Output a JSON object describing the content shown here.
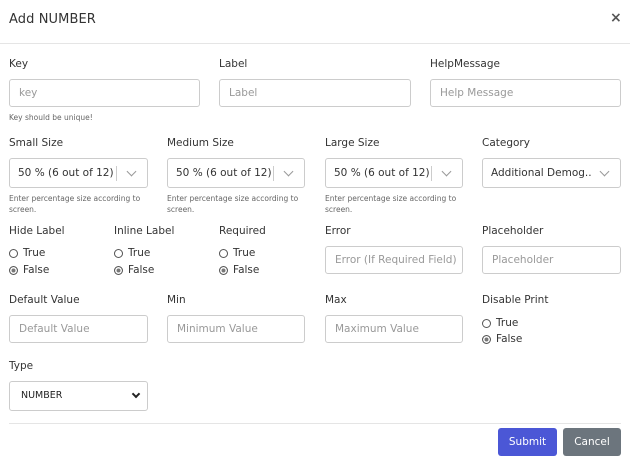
{
  "modal": {
    "title": "Add NUMBER",
    "close_icon": "×"
  },
  "fields": {
    "key": {
      "label": "Key",
      "placeholder": "key",
      "hint": "Key should be unique!"
    },
    "label": {
      "label": "Label",
      "placeholder": "Label"
    },
    "help_message": {
      "label": "HelpMessage",
      "placeholder": "Help Message"
    },
    "small_size": {
      "label": "Small Size",
      "value": "50 % (6 out of 12)",
      "hint": "Enter percentage size according to screen."
    },
    "medium_size": {
      "label": "Medium Size",
      "value": "50 % (6 out of 12)",
      "hint": "Enter percentage size according to screen."
    },
    "large_size": {
      "label": "Large Size",
      "value": "50 % (6 out of 12)",
      "hint": "Enter percentage size according to screen."
    },
    "category": {
      "label": "Category",
      "value": "Additional Demog..."
    },
    "hide_label": {
      "label": "Hide Label",
      "options": [
        "True",
        "False"
      ],
      "selected": "False"
    },
    "inline_label": {
      "label": "Inline Label",
      "options": [
        "True",
        "False"
      ],
      "selected": "False"
    },
    "required": {
      "label": "Required",
      "options": [
        "True",
        "False"
      ],
      "selected": "False"
    },
    "error": {
      "label": "Error",
      "placeholder": "Error (If Required Field)"
    },
    "placeholder": {
      "label": "Placeholder",
      "placeholder": "Placeholder"
    },
    "default_value": {
      "label": "Default Value",
      "placeholder": "Default Value"
    },
    "min": {
      "label": "Min",
      "placeholder": "Minimum Value"
    },
    "max": {
      "label": "Max",
      "placeholder": "Maximum Value"
    },
    "disable_print": {
      "label": "Disable Print",
      "options": [
        "True",
        "False"
      ],
      "selected": "False"
    },
    "type": {
      "label": "Type",
      "value": "NUMBER"
    }
  },
  "footer": {
    "submit_label": "Submit",
    "cancel_label": "Cancel"
  },
  "colors": {
    "submit_bg": "#4b57d6",
    "cancel_bg": "#6c757d"
  }
}
